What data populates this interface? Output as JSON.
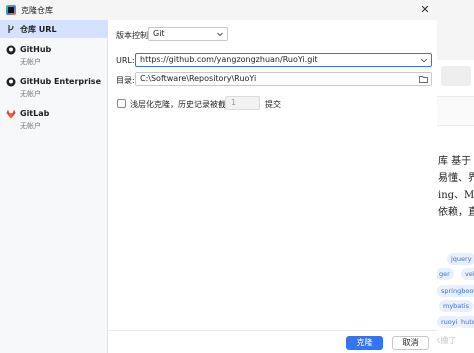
{
  "window": {
    "title": "克隆仓库"
  },
  "sidebar": {
    "items": [
      {
        "label": "仓库 URL",
        "sub": ""
      },
      {
        "label": "GitHub",
        "sub": "无帐户"
      },
      {
        "label": "GitHub Enterprise",
        "sub": "无帐户"
      },
      {
        "label": "GitLab",
        "sub": "无帐户"
      }
    ]
  },
  "form": {
    "vcs_label": "版本控制:",
    "vcs_value": "Git",
    "url_label": "URL:",
    "url_value": "https://github.com/yangzongzhuan/RuoYi.git",
    "dir_label": "目录:",
    "dir_value": "C:\\Software\\Repository\\RuoYi",
    "shallow_label": "浅层化克隆，历史记录被截断为",
    "shallow_value": "1",
    "shallow_unit": "提交"
  },
  "buttons": {
    "clone": "克隆",
    "cancel": "取消"
  },
  "background": {
    "lines": [
      "库 基于",
      "易懂、界",
      "ing、My",
      "依赖，直接"
    ],
    "tags": [
      "jquery",
      "ger",
      "veli",
      "springboot",
      "mybatis",
      "ruoyi",
      "hutoo"
    ],
    "watermark": "CSDN @白水撸了"
  },
  "colors": {
    "accent": "#3574f0",
    "selected": "#d4e2ff"
  }
}
